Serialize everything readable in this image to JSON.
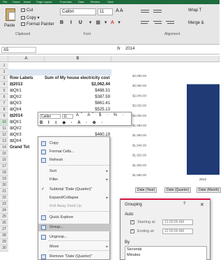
{
  "ribbon": {
    "tabs": [
      "File",
      "Home",
      "Insert",
      "Page Layout",
      "Formulas",
      "Data",
      "Review",
      "View"
    ],
    "clipboard": {
      "paste": "Paste",
      "cut": "Cut",
      "copy": "Copy",
      "format_painter": "Format Painter",
      "group_label": "Clipboard"
    },
    "font": {
      "name": "Calibri",
      "size": "11",
      "group_label": "Font",
      "format_buttons": "B I U"
    },
    "alignment": {
      "wrap": "Wrap T",
      "merge": "Merge &",
      "group_label": "Alignment"
    }
  },
  "formula_bar": {
    "name_box": "A5",
    "fx": "fx",
    "value": "2014"
  },
  "columns": [
    "A",
    "B"
  ],
  "rows": [
    {
      "num": "1",
      "a": "",
      "b": ""
    },
    {
      "num": "2",
      "a": "",
      "b": ""
    },
    {
      "num": "3",
      "a": "Row Labels",
      "b": "Sum of My house electricity cost"
    },
    {
      "num": "4",
      "a": "⊟2013",
      "b": "$2,062.44"
    },
    {
      "num": "5",
      "a": "⊞Qtr1",
      "b": "$488.31"
    },
    {
      "num": "6",
      "a": "⊞Qtr2",
      "b": "$387.59"
    },
    {
      "num": "7",
      "a": "⊞Qtr3",
      "b": "$661.41"
    },
    {
      "num": "8",
      "a": "⊞Qtr4",
      "b": "$525.13"
    },
    {
      "num": "9",
      "a": "⊟2014",
      "b": ""
    },
    {
      "num": "10",
      "a": "⊞Qtr1",
      "b": ""
    },
    {
      "num": "11",
      "a": "⊞Qtr2",
      "b": ""
    },
    {
      "num": "12",
      "a": "⊞Qtr3",
      "b": "$460.19"
    },
    {
      "num": "13",
      "a": "⊞Qtr4",
      "b": "13.50"
    },
    {
      "num": "14",
      "a": "Grand Tot",
      "b": "22.96"
    },
    {
      "num": "15",
      "a": "",
      "b": ""
    },
    {
      "num": "16",
      "a": "",
      "b": ""
    },
    {
      "num": "17",
      "a": "",
      "b": ""
    },
    {
      "num": "18",
      "a": "",
      "b": ""
    },
    {
      "num": "19",
      "a": "",
      "b": ""
    },
    {
      "num": "20",
      "a": "",
      "b": ""
    },
    {
      "num": "21",
      "a": "",
      "b": ""
    },
    {
      "num": "22",
      "a": "",
      "b": ""
    },
    {
      "num": "23",
      "a": "",
      "b": ""
    },
    {
      "num": "24",
      "a": "",
      "b": ""
    },
    {
      "num": "25",
      "a": "",
      "b": ""
    },
    {
      "num": "26",
      "a": "",
      "b": ""
    },
    {
      "num": "27",
      "a": "",
      "b": ""
    },
    {
      "num": "28",
      "a": "",
      "b": ""
    },
    {
      "num": "29",
      "a": "",
      "b": ""
    },
    {
      "num": "30",
      "a": "",
      "b": ""
    }
  ],
  "chart_data": {
    "type": "bar",
    "y_ticks": [
      "$2,080.00",
      "$2,060.00",
      "$2,040.00",
      "$2,020.00",
      "$2,000.00",
      "$1,980.00",
      "$1,960.00",
      "$1,940.00",
      "$1,920.00",
      "$1,900.00",
      "$1,880.00"
    ],
    "ylim": [
      1880,
      2080
    ],
    "categories": [
      "2013"
    ],
    "values": [
      2062.44
    ],
    "field_buttons": [
      "Date (Year)",
      "Date (Quarter)",
      "Date (Month)"
    ]
  },
  "mini_toolbar": {
    "font": "Calibri",
    "size": "11",
    "tools_row1": "Aˆ Aˇ $ · % ·",
    "tools_row2": "B I ≡ ◆ · A · ⊕ ·"
  },
  "context_menu": {
    "items": [
      {
        "label": "Copy",
        "disabled": false
      },
      {
        "label": "Format Cells...",
        "disabled": false
      },
      {
        "label": "Refresh",
        "disabled": false
      },
      {
        "label": "Sort",
        "disabled": false,
        "submenu": true
      },
      {
        "label": "Filter",
        "disabled": false,
        "submenu": true
      },
      {
        "label": "Subtotal \"Date (Quarter)\"",
        "disabled": false
      },
      {
        "label": "Expand/Collapse",
        "disabled": false,
        "submenu": true
      },
      {
        "label": "Roll Away Field Up",
        "disabled": true
      },
      {
        "label": "Quick Explore",
        "disabled": false
      },
      {
        "label": "Group...",
        "disabled": false
      },
      {
        "label": "Ungroup...",
        "disabled": false
      },
      {
        "label": "Move",
        "disabled": false,
        "submenu": true
      },
      {
        "label": "Remove \"Date (Quarter)\"",
        "disabled": false
      }
    ]
  },
  "grouping_dialog": {
    "title": "Grouping",
    "help": "?",
    "close": "✕",
    "auto_label": "Auto",
    "starting_at_label": "Starting at:",
    "starting_at_value": "12:00:00 AM",
    "ending_at_label": "Ending at:",
    "ending_at_value": "12:00:00 AM",
    "by_label": "By",
    "by_options": [
      "Seconds",
      "Minutes"
    ]
  },
  "colors": {
    "ribbon_tab_green": "#1d6b3c",
    "chart_bar": "#1f3a75",
    "dialog_accent": "#d14"
  }
}
